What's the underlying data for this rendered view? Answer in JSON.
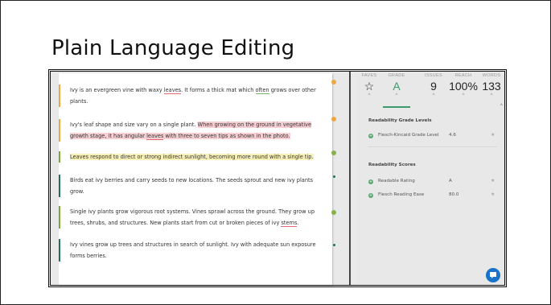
{
  "slide": {
    "title": "Plain Language Editing"
  },
  "editor": {
    "paragraphs": [
      {
        "segments": [
          "Ivy is an evergreen vine with waxy ",
          "leaves",
          ". It forms a thick mat which ",
          "often",
          " grows over other plants."
        ]
      },
      {
        "segments": [
          "Ivy's leaf shape and size vary on a single plant. ",
          "When growing on the ground in vegetative growth stage, it has angular ",
          "leaves",
          " with three to seven tips as shown in the photo."
        ]
      },
      {
        "segments": [
          "Leaves respond to direct or strong indirect sunlight, becoming more round with a single tip."
        ]
      },
      {
        "segments": [
          "Birds eat ivy berries and carry seeds to new locations. The seeds sprout and new ivy plants grow."
        ]
      },
      {
        "segments": [
          "Single ivy plants grow vigorous root systems. Vines sprawl across the ground. They grow up trees, shrubs, and structures. New plants start from cut or broken pieces of ivy ",
          "stems",
          "."
        ]
      },
      {
        "segments": [
          "Ivy vines grow up trees and structures in search of sunlight. Ivy with adequate sun exposure forms berries."
        ]
      }
    ]
  },
  "stats": {
    "faves": {
      "label": "FAVES",
      "icon": "star-outline-icon"
    },
    "grade": {
      "label": "GRADE",
      "value": "A"
    },
    "issues": {
      "label": "ISSUES",
      "value": "9"
    },
    "reach": {
      "label": "REACH",
      "value": "100%"
    },
    "words": {
      "label": "WORDS",
      "value": "133"
    }
  },
  "readability_grade": {
    "title": "Readability Grade Levels",
    "rows": [
      {
        "name": "Flesch-Kincaid Grade Level",
        "value": "4.6"
      }
    ]
  },
  "readability_scores": {
    "title": "Readability Scores",
    "rows": [
      {
        "name": "Readable Rating",
        "value": "A"
      },
      {
        "name": "Flesch Reading Ease",
        "value": "80.0"
      }
    ]
  },
  "colors": {
    "accent_green": "#3d9a6a",
    "chat_button": "#1a73c9",
    "bar_orange": "#f0a640",
    "bar_green": "#7aa83c",
    "bar_teal": "#1f6f57"
  }
}
